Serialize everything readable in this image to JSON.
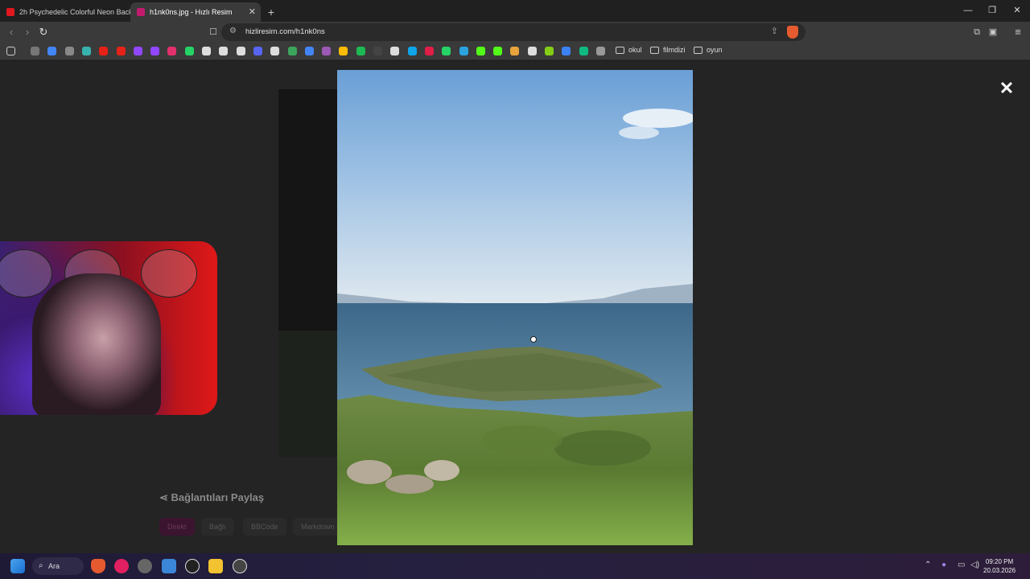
{
  "browser": {
    "tabs": [
      {
        "title": "2h Psychedelic Colorful Neon Backgr",
        "favicon_color": "#e0181e",
        "active": false
      },
      {
        "title": "h1nk0ns.jpg - Hızlı Resim",
        "favicon_color": "#c21a6e",
        "active": true
      }
    ],
    "address": "hizliresim.com/h1nk0ns",
    "bookmark_folders": [
      "okul",
      "filmdizi",
      "oyun"
    ],
    "bookmark_icon_colors": [
      "#777",
      "#4285f4",
      "#888",
      "#38b2ac",
      "#e62117",
      "#e62117",
      "#9146ff",
      "#9146ff",
      "#e1306c",
      "#25d366",
      "#ddd",
      "#ddd",
      "#ddd",
      "#5865f2",
      "#ddd",
      "#3ba55c",
      "#4285f4",
      "#9b59b6",
      "#fbbc04",
      "#1db954",
      "#444",
      "#ddd",
      "#0ea5e9",
      "#e11d48",
      "#25d366",
      "#2aa3df",
      "#53fc18",
      "#53fc18",
      "#e8a33d",
      "#ddd",
      "#84cc16",
      "#3b82f6",
      "#10b981",
      "#999"
    ]
  },
  "page": {
    "share_heading": "Bağlantıları Paylaş",
    "share_tabs": [
      "Direkt",
      "Bağlı",
      "BBCode",
      "Markdown"
    ],
    "close_symbol": "✕"
  },
  "taskbar": {
    "search_label": "Ara",
    "time": "09:20 PM",
    "date": "20.03.2026"
  }
}
